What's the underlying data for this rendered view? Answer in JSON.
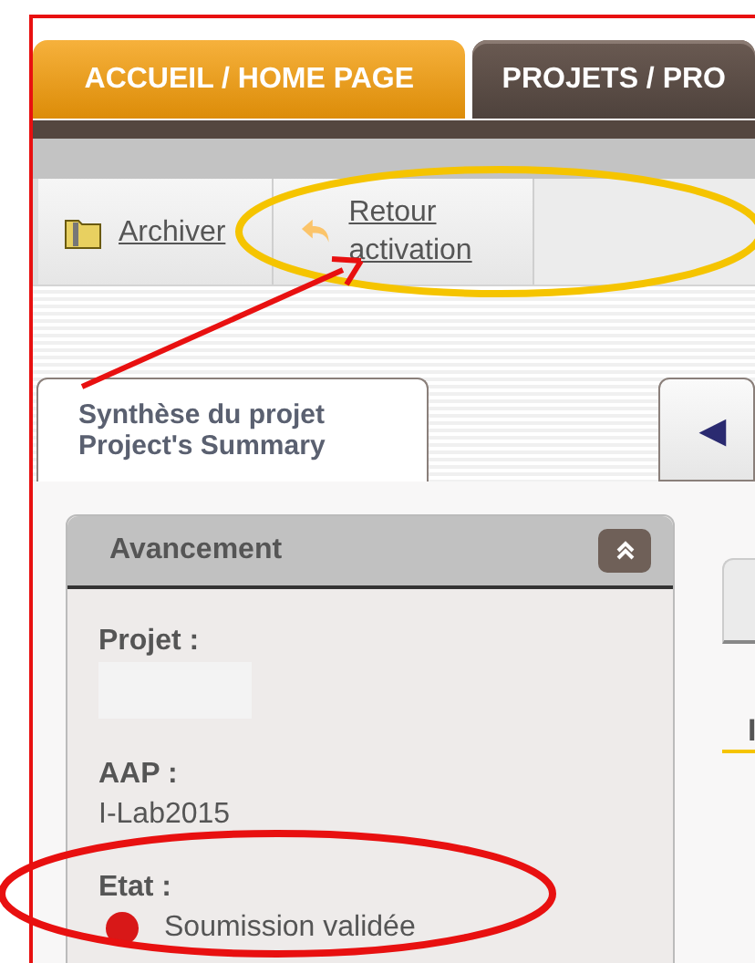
{
  "nav_tabs": [
    {
      "label": "ACCUEIL / HOME PAGE",
      "selected": false,
      "kind": "orange"
    },
    {
      "label": "PROJETS / PRO",
      "selected": true,
      "kind": "dark"
    }
  ],
  "toolbar": [
    {
      "label": "Archiver",
      "kind": "archive"
    },
    {
      "label": "Retour activation",
      "kind": "undo"
    }
  ],
  "content_tabs": [
    {
      "label": "Synthèse du projet\nProject's Summary",
      "selected": true
    },
    {
      "label": "◀",
      "selected": false
    }
  ],
  "panel": {
    "title": "Avancement",
    "expanded": true,
    "fields": [
      {
        "label": "Projet :",
        "redacted": true
      },
      {
        "label": "AAP :",
        "value": "I-Lab2015"
      },
      {
        "label": "Etat :",
        "value": "Soumission validée",
        "color": "#d81818"
      }
    ]
  },
  "side_heading": "I",
  "annotations": [
    {
      "kind": "ellipse",
      "color": "#f5c400"
    },
    {
      "kind": "arrow",
      "color": "#e81010"
    },
    {
      "kind": "ellipse",
      "color": "#e81010"
    }
  ]
}
